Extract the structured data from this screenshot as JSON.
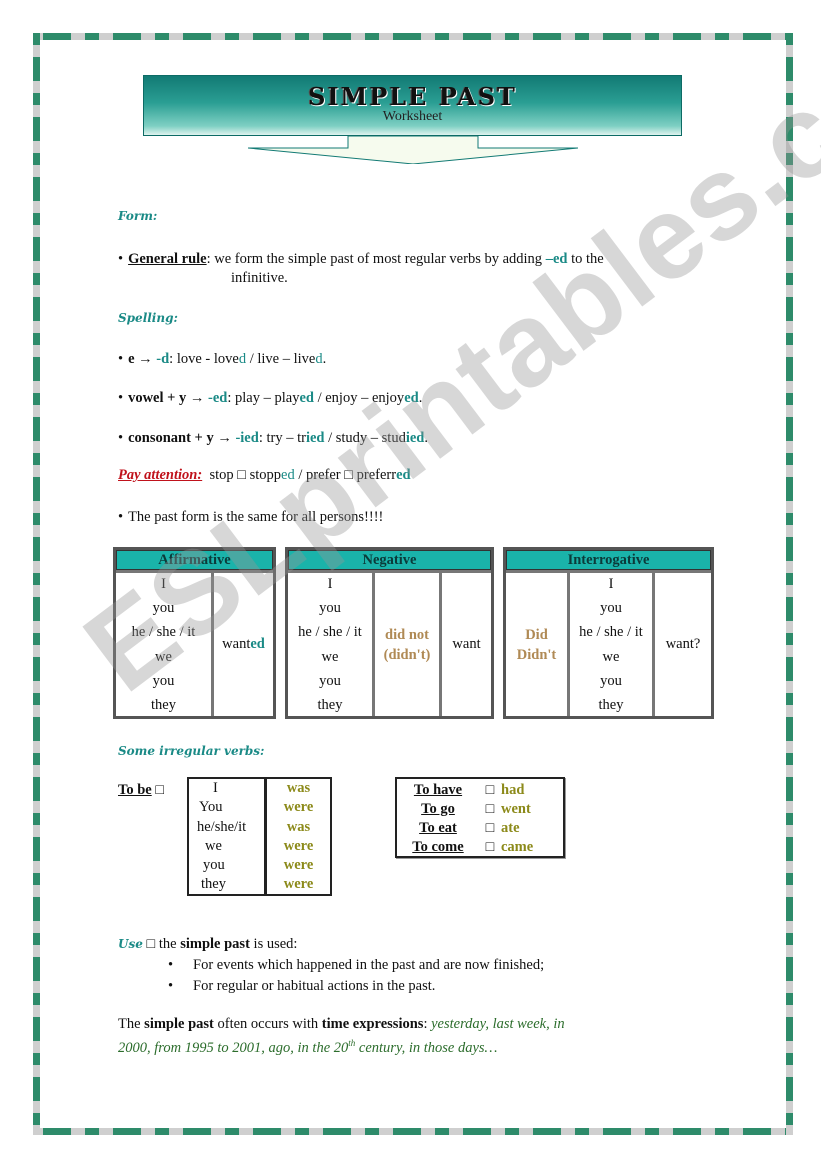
{
  "header": {
    "title": "SIMPLE PAST",
    "subtitle": "Worksheet"
  },
  "form": {
    "label": "Form:",
    "general_rule_label": "General rule",
    "general_rule_text_1": ": we form the simple past of most regular verbs by adding ",
    "general_rule_suffix": "–ed",
    "general_rule_text_2": " to the",
    "general_rule_text_3": "infinitive."
  },
  "spelling": {
    "label": "Spelling:",
    "rules": [
      {
        "pattern": "e",
        "arrow": " → ",
        "suffix": "-d",
        "examples": [
          ": love - love",
          "d",
          " / live – live",
          "d",
          "."
        ]
      },
      {
        "pattern": "vowel + y",
        "arrow": " → ",
        "suffix": "-ed",
        "examples": [
          ": play – play",
          "ed",
          " / enjoy – enjoy",
          "ed",
          "."
        ]
      },
      {
        "pattern": "consonant + y",
        "arrow": " → ",
        "suffix": "-ied",
        "examples": [
          ": try – tr",
          "ied",
          " / study – stud",
          "ied",
          "."
        ]
      }
    ],
    "attention_label": "Pay attention:",
    "attention_parts": [
      "stop",
      "□",
      "stopp",
      "ed",
      " / prefer",
      "□",
      "preferr",
      "ed"
    ],
    "same_for_all": "The past form is the same for all persons!!!!"
  },
  "conjugation": {
    "pronouns": [
      "I",
      "you",
      "he / she / it",
      "we",
      "you",
      "they"
    ],
    "affirmative": {
      "header": "Affirmative",
      "verb_stem": "want",
      "verb_suffix": "ed"
    },
    "negative": {
      "header": "Negative",
      "aux_1": "did not",
      "aux_2": "(didn't)",
      "verb": "want"
    },
    "interrogative": {
      "header": "Interrogative",
      "aux_1": "Did",
      "aux_2": "Didn't",
      "verb": "want?"
    }
  },
  "irregular": {
    "label": "Some irregular verbs:",
    "to_be_label": "To be",
    "to_be_arrow": "□",
    "to_be_rows": [
      {
        "pronoun": "I",
        "form": "was"
      },
      {
        "pronoun": "You",
        "form": "were"
      },
      {
        "pronoun": "he/she/it",
        "form": "was"
      },
      {
        "pronoun": "we",
        "form": "were"
      },
      {
        "pronoun": "you",
        "form": "were"
      },
      {
        "pronoun": "they",
        "form": "were"
      }
    ],
    "others": [
      {
        "verb": "To have",
        "arrow": "□",
        "past": "had"
      },
      {
        "verb": "To go",
        "arrow": "□",
        "past": "went"
      },
      {
        "verb": "To eat",
        "arrow": "□",
        "past": "ate"
      },
      {
        "verb": "To come",
        "arrow": "□",
        "past": "came"
      }
    ]
  },
  "use": {
    "label": "Use",
    "arrow": "□",
    "intro_1": " the ",
    "intro_bold": "simple past",
    "intro_2": " is used:",
    "items": [
      "For events which happened in the past and are now finished;",
      "For regular or habitual actions in the past."
    ]
  },
  "time_expr": {
    "t1": "The ",
    "b1": "simple past",
    "t2": " often occurs with ",
    "b2": "time expressions",
    "t3": ": ",
    "line1_italic": "yesterday, last week, in",
    "line2_italic_a": "2000, from 1995 to 2001, ago, in the 20",
    "sup": "th",
    "line2_italic_b": " century, in those days…"
  },
  "watermark": "ESLprintables.com"
}
